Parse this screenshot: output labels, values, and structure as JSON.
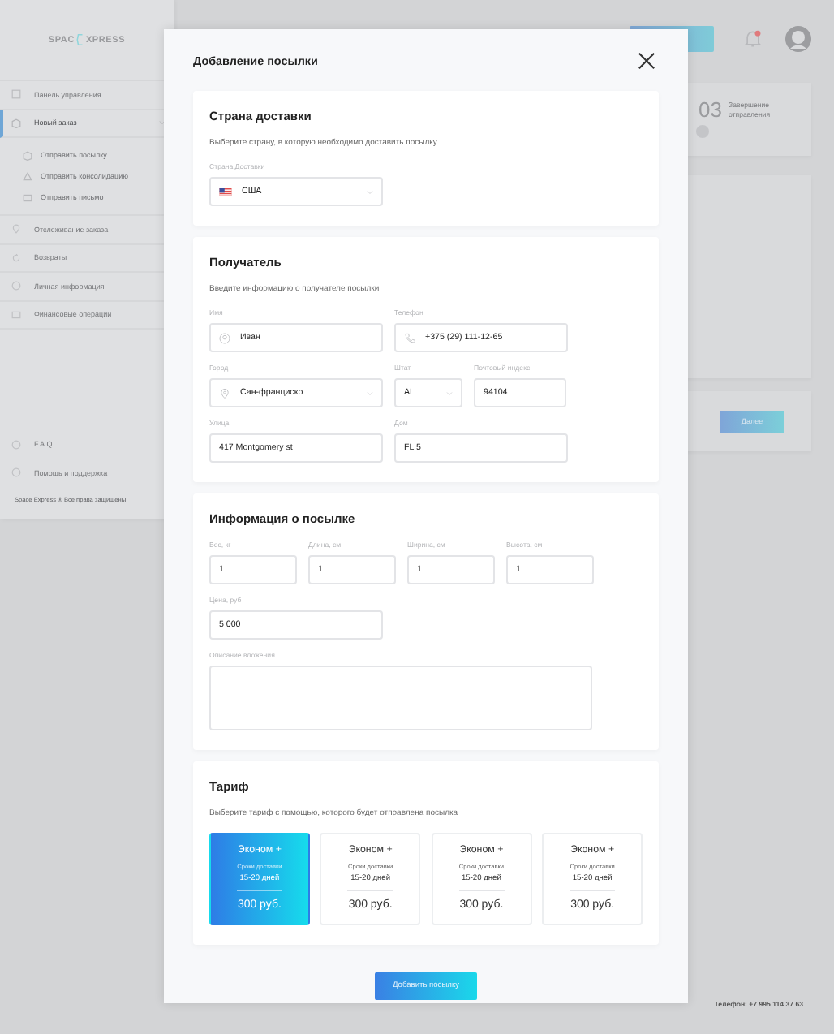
{
  "background": {
    "logo": {
      "left": "SPAC",
      "right": "XPRESS"
    },
    "sidebar": {
      "items": [
        {
          "label": "Панель управления",
          "selected": false
        },
        {
          "label": "Новый заказ",
          "selected": true,
          "children": [
            {
              "label": "Отправить посылку"
            },
            {
              "label": "Отправить консолидацию"
            },
            {
              "label": "Отправить письмо"
            }
          ]
        },
        {
          "label": "Отслеживание заказа",
          "selected": false
        },
        {
          "label": "Возвраты",
          "selected": false
        },
        {
          "label": "Личная информация",
          "selected": false
        },
        {
          "label": "Финансовые операции",
          "selected": false
        }
      ],
      "footer_items": [
        {
          "label": "F.A.Q"
        },
        {
          "label": "Помощь и поддержка"
        }
      ],
      "copyright": "Space Express ® Все права защищены"
    },
    "header": {
      "notification_unread": true
    },
    "step_card": {
      "number": "03",
      "label": "Завершение отправления"
    },
    "next_button": "Далее",
    "footer_phone": "Телефон: +7 995 114 37 63"
  },
  "modal": {
    "title": "Добавление посылки",
    "sections": [
      {
        "title": "Страна доставки",
        "description": "Выберите страну, в которую необходимо доставить посылку",
        "rows": [
          [
            {
              "kind": "country",
              "label": "Страна Доставки",
              "value": "США"
            }
          ]
        ]
      },
      {
        "title": "Получатель",
        "description": "Введите информацию о получателе  посылки",
        "rows": [
          [
            {
              "kind": "name",
              "label": "Имя",
              "value": "Иван"
            },
            {
              "kind": "phone",
              "label": "Телефон",
              "value": "+375 (29) 111-12-65"
            }
          ],
          [
            {
              "kind": "city",
              "label": "Город",
              "value": "Сан-франциско"
            },
            {
              "kind": "state",
              "label": "Штат",
              "value": "AL"
            },
            {
              "kind": "postcode",
              "label": "Почтовый индекс",
              "value": "94104"
            }
          ],
          [
            {
              "kind": "text",
              "label": "Улица",
              "value": "417  Montgomery st"
            },
            {
              "kind": "text",
              "label": "Дом",
              "value": "FL 5"
            }
          ]
        ]
      },
      {
        "title": "Информация о посылке",
        "rows": [
          [
            {
              "kind": "number",
              "label": "Вес, кг",
              "value": "1"
            },
            {
              "kind": "number",
              "label": "Длина, см",
              "value": "1"
            },
            {
              "kind": "number",
              "label": "Ширина, см",
              "value": "1"
            },
            {
              "kind": "number",
              "label": "Высота, см",
              "value": "1"
            }
          ],
          [
            {
              "kind": "text",
              "label": "Цена, руб",
              "value": "5 000"
            }
          ],
          [
            {
              "kind": "textarea",
              "label": "Описание вложения"
            }
          ]
        ]
      },
      {
        "title": "Тариф",
        "description": "Выберите тариф с помощью, которого  будет отправлена посылка",
        "tariffs": [
          {
            "name": "Эконом +",
            "term_label": "Сроки доставки",
            "term": "15-20 дней",
            "price": "300 руб.",
            "selected": true
          },
          {
            "name": "Эконом +",
            "term_label": "Сроки доставки",
            "term": "15-20 дней",
            "price": "300 руб.",
            "selected": false
          },
          {
            "name": "Эконом +",
            "term_label": "Сроки доставки",
            "term": "15-20 дней",
            "price": "300 руб.",
            "selected": false
          },
          {
            "name": "Эконом +",
            "term_label": "Сроки доставки",
            "term": "15-20 дней",
            "price": "300 руб.",
            "selected": false
          }
        ]
      }
    ],
    "submit_button": "Добавить посылку"
  }
}
